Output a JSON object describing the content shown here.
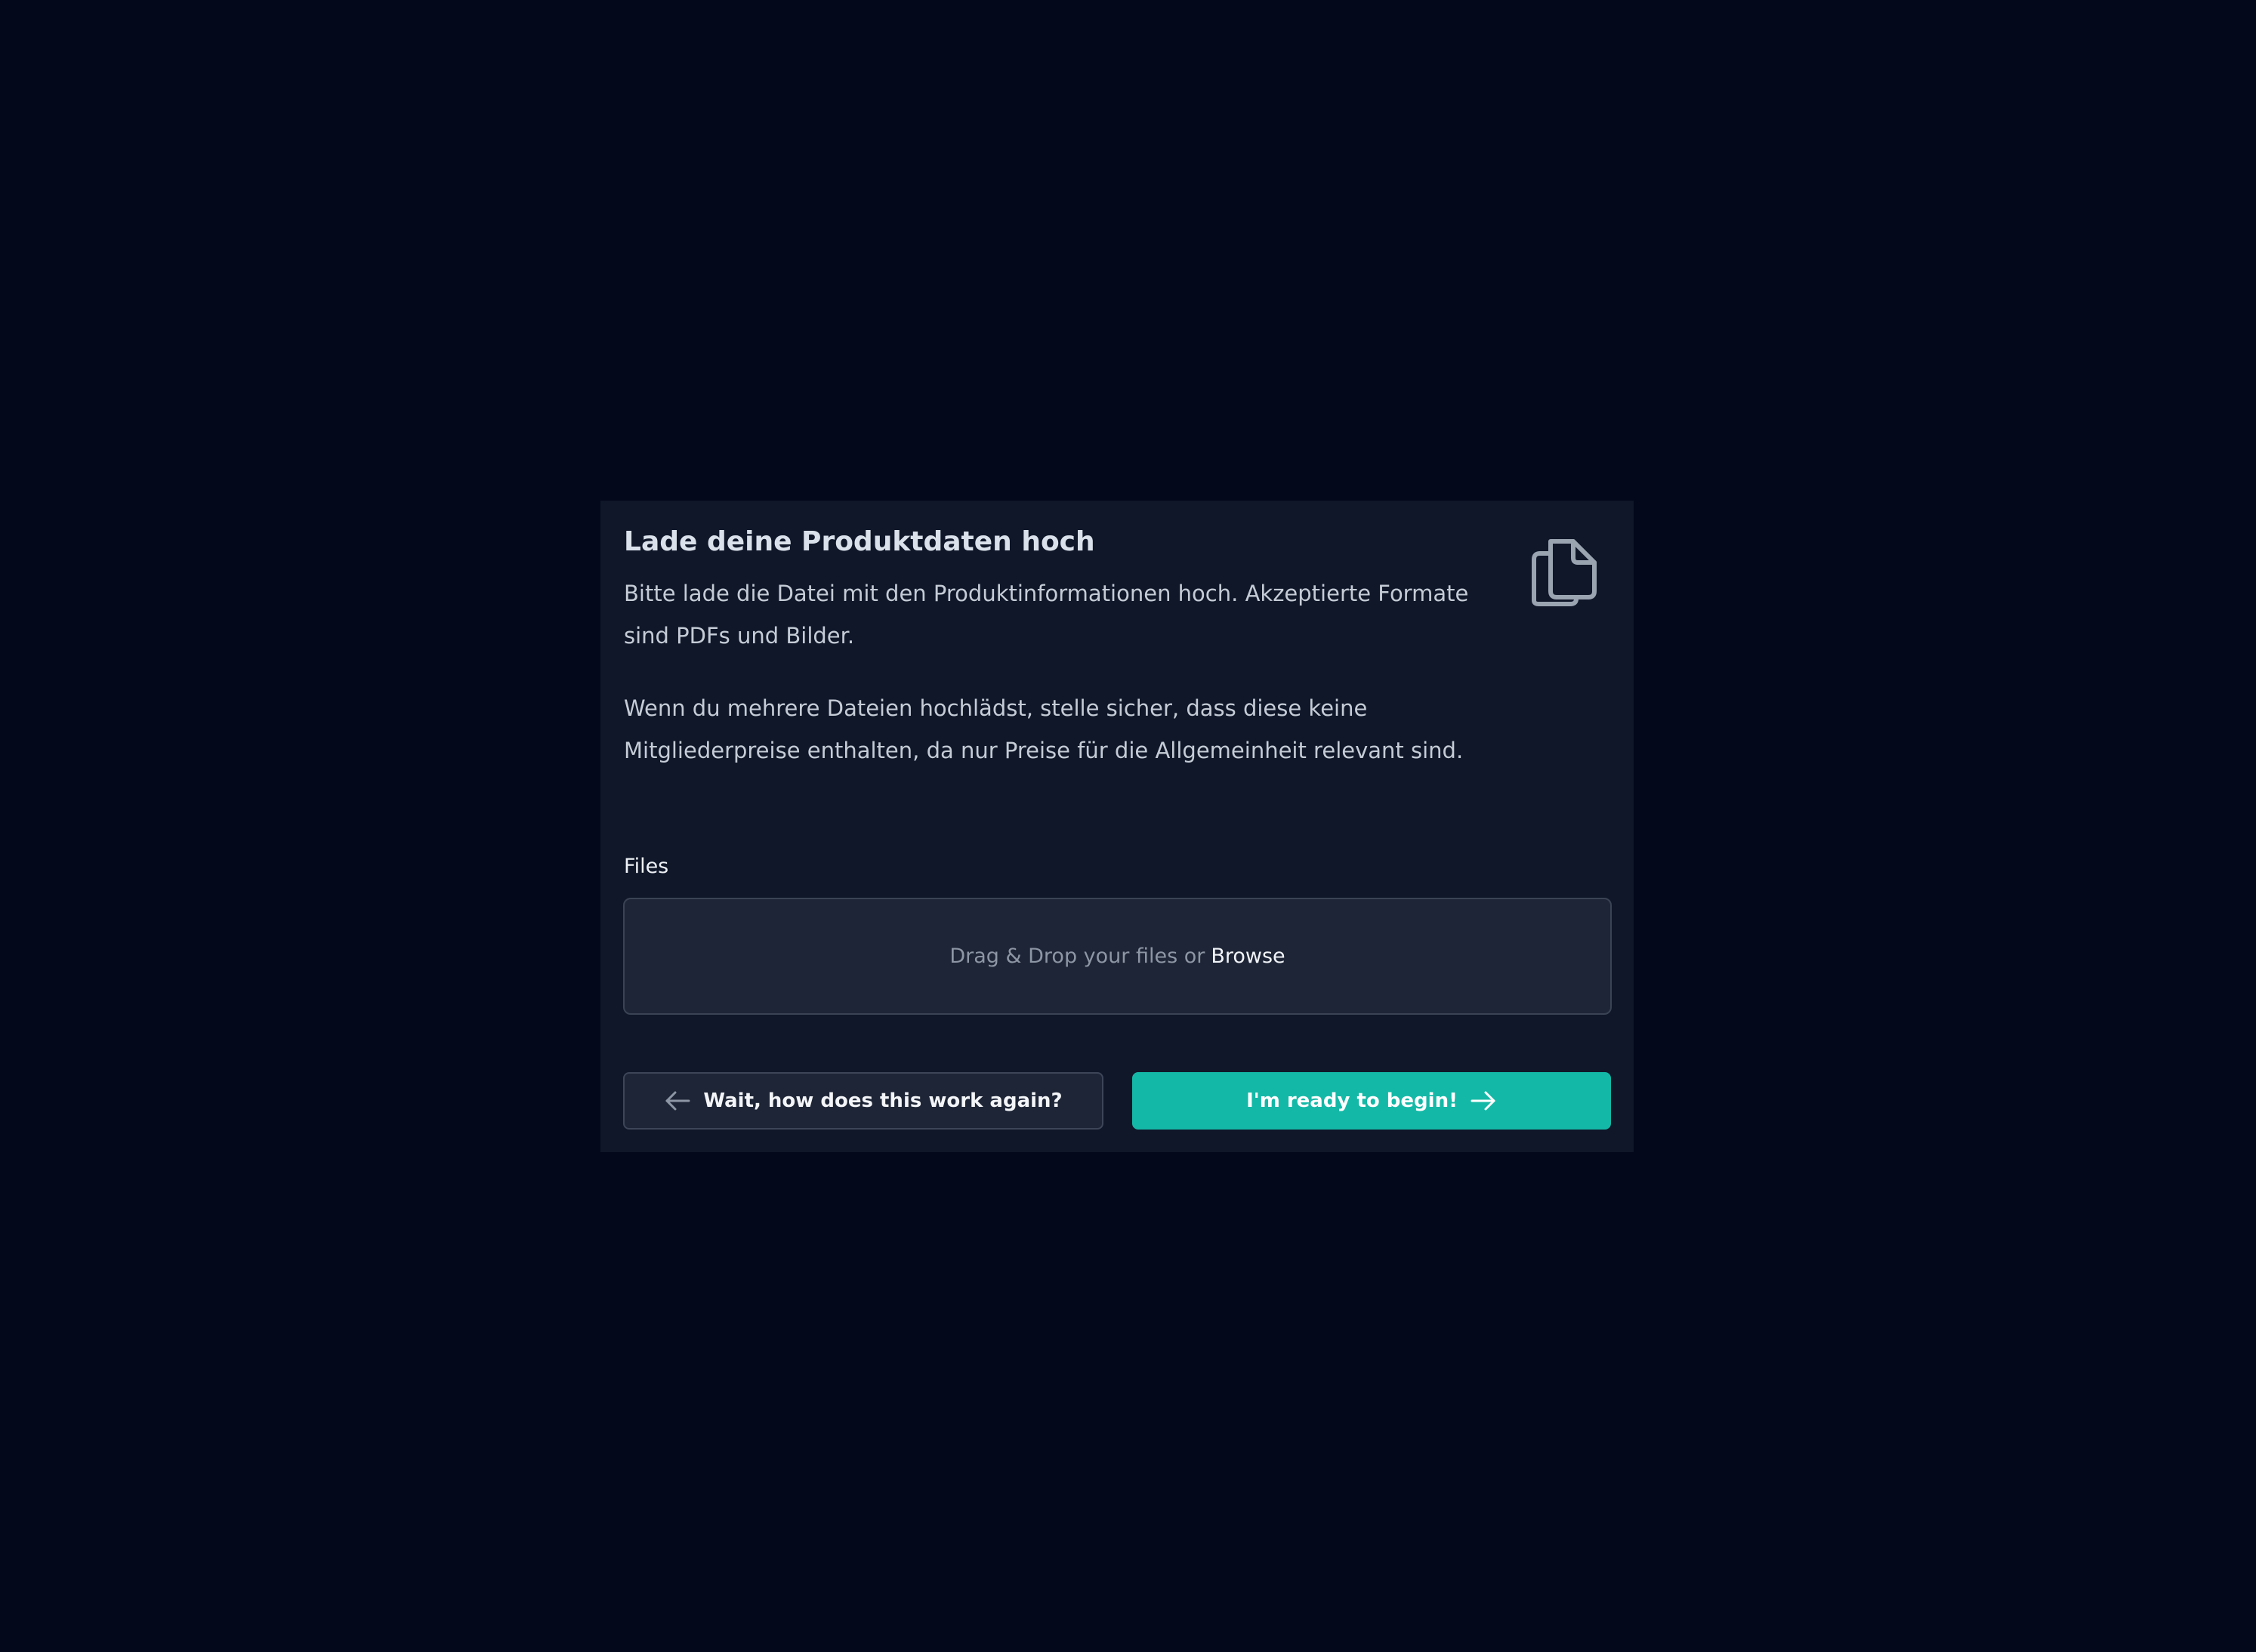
{
  "dialog": {
    "title": "Lade deine Produktdaten hoch",
    "description_1": "Bitte lade die Datei mit den Produktinformationen hoch. Akzeptierte Formate sind PDFs und Bilder.",
    "description_2": "Wenn du mehrere Dateien hochlädst, stelle sicher, dass diese keine Mitgliederpreise enthalten, da nur Preise für die Allgemeinheit relevant sind.",
    "icon": "documents-icon"
  },
  "upload": {
    "label": "Files",
    "dropzone_text": "Drag & Drop your files or",
    "browse_label": "Browse"
  },
  "actions": {
    "back_label": "Wait, how does this work again?",
    "back_icon": "arrow-left-icon",
    "start_label": "I'm ready to begin!",
    "start_icon": "arrow-right-icon"
  },
  "colors": {
    "page_background": "#03081a",
    "card_background": "#0f1729",
    "dropzone_background": "#1e2536",
    "accent": "#14b8a6"
  }
}
